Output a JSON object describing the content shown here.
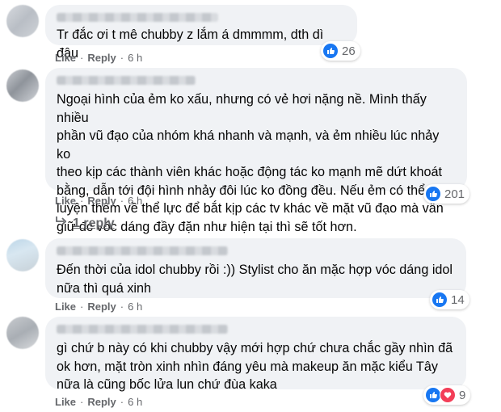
{
  "colors": {
    "bubble_bg": "#f0f2f5",
    "meta_text": "#65676b",
    "like_blue": "#1877f2",
    "love_red": "#f33e58"
  },
  "comments": [
    {
      "text": "Tr đắc ơi t mê chubby z lắm á dmmmm, dth dì đâu",
      "like_label": "Like",
      "reply_label": "Reply",
      "time": "6 h",
      "reactions": [
        "like-icon"
      ],
      "reaction_count": "26"
    },
    {
      "text": "Ngoại hình của ẻm ko xấu, nhưng có vẻ hơi nặng nề. Mình thấy nhiều\nphần vũ đạo của nhóm khá nhanh và mạnh, và ẻm nhiều lúc nhảy ko\ntheo kịp các thành viên khác hoặc động tác ko mạnh mẽ dứt khoát\nbằng, dẫn tới đội hình nhảy đôi lúc ko đồng đều. Nếu ẻm có thể rèn\nluyện thêm về thể lực để bắt kịp các tv khác về mặt vũ đạo mà vẫn\ngiữ đc vóc dáng đầy đặn như hiện tại thì sẽ tốt hơn.",
      "like_label": "Like",
      "reply_label": "Reply",
      "time": "6 h",
      "reactions": [
        "like-icon"
      ],
      "reaction_count": "201",
      "replies_label": "1 reply"
    },
    {
      "text": "Đến thời của idol chubby rồi :)) Stylist cho ăn mặc hợp vóc dáng idol\nnữa thì quá xinh",
      "like_label": "Like",
      "reply_label": "Reply",
      "time": "6 h",
      "reactions": [
        "like-icon"
      ],
      "reaction_count": "14"
    },
    {
      "text": "gì chứ b này có khi chubby vậy mới hợp chứ chưa chắc gầy nhìn đã\nok hơn, mặt tròn xinh nhìn đáng yêu mà makeup ăn mặc kiểu Tây\nnữa là cũng bốc lửa lun chứ đùa kaka",
      "like_label": "Like",
      "reply_label": "Reply",
      "time": "6 h",
      "reactions": [
        "like-icon",
        "love-icon"
      ],
      "reaction_count": "9"
    }
  ]
}
